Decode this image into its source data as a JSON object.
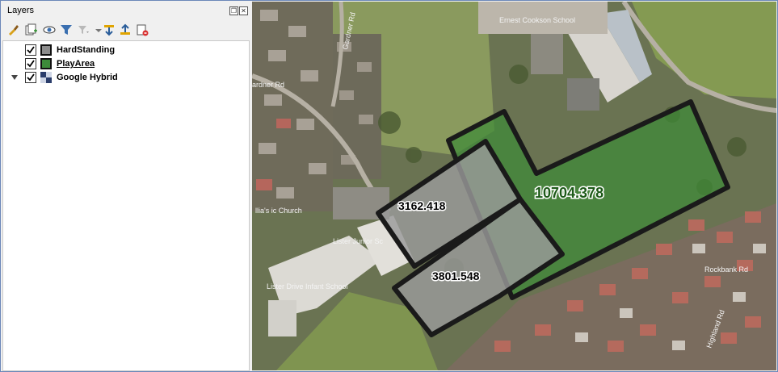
{
  "panel": {
    "title": "Layers"
  },
  "toolbar": {
    "icons": [
      "style-brush-icon",
      "add-group-icon",
      "manage-visibility-icon",
      "filter-icon",
      "filter-expression-icon",
      "expand-all-icon",
      "collapse-all-icon",
      "remove-layer-icon"
    ]
  },
  "layers": [
    {
      "name": "HardStanding",
      "checked": true,
      "symbol_color": "#8c8c8c"
    },
    {
      "name": "PlayArea",
      "checked": true,
      "symbol_color": "#3d8b3a"
    },
    {
      "name": "Google Hybrid",
      "checked": true,
      "expanded": true
    }
  ],
  "map": {
    "labels": {
      "play_area": "10704.378",
      "hard_a": "3162.418",
      "hard_b": "3801.548",
      "school_top": "Ernest Cookson School",
      "church": "llia's ic Church",
      "lister_junior": "Lister Junior Sc",
      "lister_infant": "Lister Drive Infant School",
      "road_gardner": "Gardner Rd",
      "road_ardner": "ardner Rd",
      "road_rockbank": "Rockbank Rd",
      "road_highland": "Highland Rd"
    },
    "colors": {
      "play_area_fill": "#3f8a38",
      "play_area_label": "#1d5a18",
      "hard_fill": "#9a9a9a",
      "outline": "#1a1a1a"
    }
  }
}
